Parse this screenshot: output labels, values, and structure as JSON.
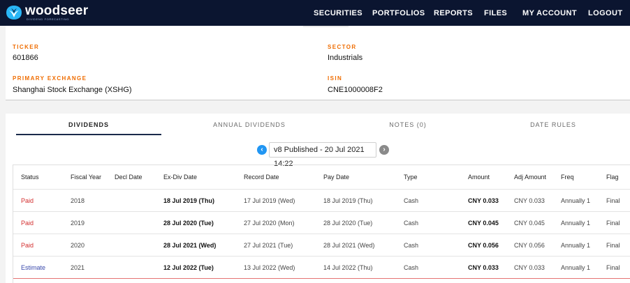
{
  "app": {
    "brand": "woodseer",
    "tagline": "DIVIDEND FORECASTING"
  },
  "nav": {
    "items": [
      "SECURITIES",
      "PORTFOLIOS",
      "REPORTS",
      "FILES",
      "MY ACCOUNT",
      "LOGOUT"
    ]
  },
  "security": {
    "ticker_label": "TICKER",
    "ticker": "601866",
    "sector_label": "SECTOR",
    "sector": "Industrials",
    "exchange_label": "PRIMARY EXCHANGE",
    "exchange": "Shanghai Stock Exchange (XSHG)",
    "isin_label": "ISIN",
    "isin": "CNE1000008F2"
  },
  "tabs": [
    "DIVIDENDS",
    "ANNUAL DIVIDENDS",
    "NOTES (0)",
    "DATE RULES"
  ],
  "version": {
    "label": "v8 Published - 20 Jul 2021 14:22"
  },
  "table": {
    "columns": [
      "Status",
      "Fiscal Year",
      "Decl Date",
      "Ex-Div Date",
      "Record Date",
      "Pay Date",
      "Type",
      "Amount",
      "Adj Amount",
      "Freq",
      "Flag"
    ],
    "rows": [
      {
        "status": "Paid",
        "fiscal_year": "2018",
        "decl_date": "",
        "ex_div": "18 Jul 2019 (Thu)",
        "record": "17 Jul 2019 (Wed)",
        "pay": "18 Jul 2019 (Thu)",
        "type": "Cash",
        "amount": "CNY 0.033",
        "adj_amount": "CNY 0.033",
        "freq": "Annually 1",
        "flag": "Final"
      },
      {
        "status": "Paid",
        "fiscal_year": "2019",
        "decl_date": "",
        "ex_div": "28 Jul 2020 (Tue)",
        "record": "27 Jul 2020 (Mon)",
        "pay": "28 Jul 2020 (Tue)",
        "type": "Cash",
        "amount": "CNY 0.045",
        "adj_amount": "CNY 0.045",
        "freq": "Annually 1",
        "flag": "Final"
      },
      {
        "status": "Paid",
        "fiscal_year": "2020",
        "decl_date": "",
        "ex_div": "28 Jul 2021 (Wed)",
        "record": "27 Jul 2021 (Tue)",
        "pay": "28 Jul 2021 (Wed)",
        "type": "Cash",
        "amount": "CNY 0.056",
        "adj_amount": "CNY 0.056",
        "freq": "Annually 1",
        "flag": "Final"
      },
      {
        "status": "Estimate",
        "fiscal_year": "2021",
        "decl_date": "",
        "ex_div": "12 Jul 2022 (Tue)",
        "record": "13 Jul 2022 (Wed)",
        "pay": "14 Jul 2022 (Thu)",
        "type": "Cash",
        "amount": "CNY 0.033",
        "adj_amount": "CNY 0.033",
        "freq": "Annually 1",
        "flag": "Final"
      }
    ]
  },
  "colors": {
    "nav_bg": "#0b1530",
    "label_orange": "#ef6c00",
    "paid": "#d32f2f",
    "estimate": "#3949ab",
    "accent": "#2196f3"
  },
  "icons": {
    "brand": "woodseer-logo-icon",
    "prev": "chevron-left-icon",
    "next": "chevron-right-icon"
  }
}
